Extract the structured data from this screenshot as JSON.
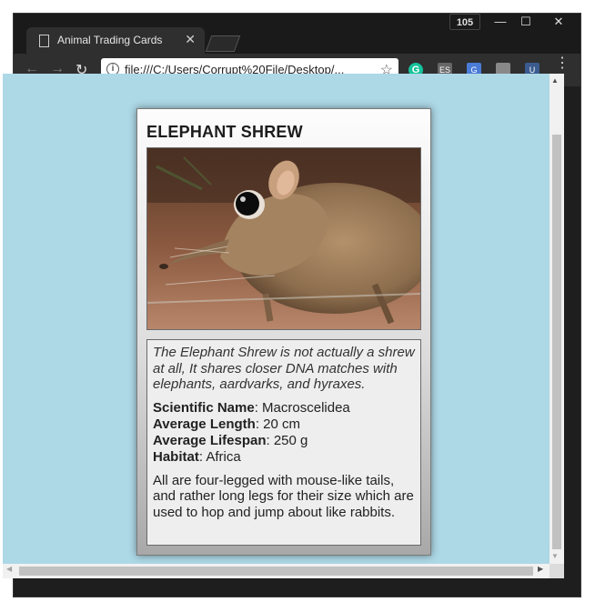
{
  "browser": {
    "tab_title": "Animal Trading Cards",
    "tab_close": "✕",
    "badge": "105",
    "url": "file:///C:/Users/Corrupt%20File/Desktop/...",
    "extensions": [
      "G",
      "ES",
      "G",
      "",
      "U"
    ]
  },
  "card": {
    "title": "ELEPHANT SHREW",
    "intro": "The Elephant Shrew is not actually a shrew at all, It shares closer DNA matches with elephants, aardvarks, and hyraxes.",
    "facts": [
      {
        "label": "Scientific Name",
        "value": ": Macroscelidea"
      },
      {
        "label": "Average Length",
        "value": ": 20 cm"
      },
      {
        "label": "Average Lifespan",
        "value": ": 250 g"
      },
      {
        "label": "Habitat",
        "value": ": Africa"
      }
    ],
    "body": "All are four-legged with mouse-like tails, and rather long legs for their size which are used to hop and jump about like rabbits."
  },
  "colors": {
    "page_background": "#add8e6",
    "chrome_dark": "#1e1e1e"
  }
}
